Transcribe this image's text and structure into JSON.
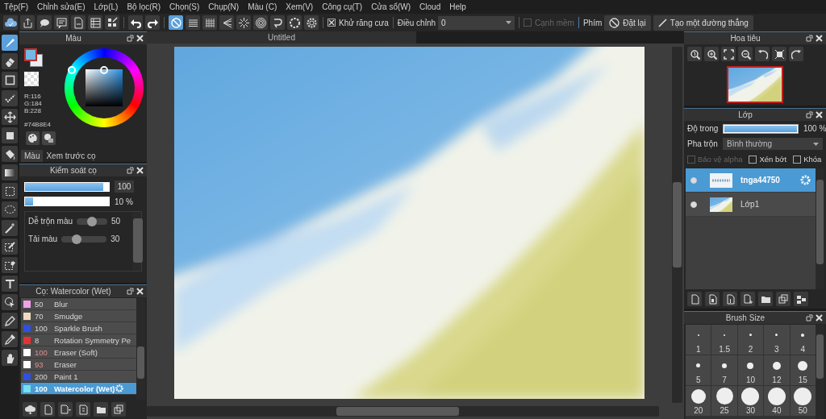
{
  "menu": [
    "Tệp(F)",
    "Chỉnh sửa(E)",
    "Lớp(L)",
    "Bộ lọc(R)",
    "Chọn(S)",
    "Chụp(N)",
    "Màu (C)",
    "Xem(V)",
    "Công cụ(T)",
    "Cửa sổ(W)",
    "Cloud",
    "Help"
  ],
  "toolbar": {
    "snap_tools": [
      {
        "kind": "off",
        "selected": true
      },
      {
        "kind": "parallel",
        "selected": false
      },
      {
        "kind": "grid",
        "selected": false
      },
      {
        "kind": "focus",
        "selected": false
      },
      {
        "kind": "radial",
        "selected": false
      },
      {
        "kind": "concentric",
        "selected": false
      },
      {
        "kind": "curve",
        "selected": false
      },
      {
        "kind": "circle",
        "selected": false
      },
      {
        "kind": "gear",
        "selected": false
      }
    ],
    "antialias": {
      "label": "Khử răng cưa",
      "checked": true
    },
    "correction": {
      "label": "Điều chỉnh",
      "value": "0"
    },
    "soft_edge": {
      "label": "Cạnh mềm",
      "checked": false,
      "disabled": true
    },
    "key_label": "Phím",
    "reset_button": "Đặt lại",
    "line_button": "Tạo một đường thẳng"
  },
  "tools": [
    {
      "kind": "brush",
      "selected": true
    },
    {
      "kind": "eraser",
      "selected": false
    },
    {
      "kind": "dot",
      "selected": false
    },
    {
      "kind": "graphic",
      "selected": false
    },
    {
      "kind": "move",
      "selected": false
    },
    {
      "kind": "fill",
      "selected": false
    },
    {
      "kind": "bucket",
      "selected": false
    },
    {
      "kind": "gradient",
      "selected": false
    },
    {
      "kind": "select",
      "selected": false
    },
    {
      "kind": "lasso",
      "selected": false
    },
    {
      "kind": "wand",
      "selected": false
    },
    {
      "kind": "select_pen",
      "selected": false
    },
    {
      "kind": "select_eraser",
      "selected": false
    },
    {
      "kind": "text",
      "selected": false
    },
    {
      "kind": "operation",
      "selected": false
    },
    {
      "kind": "pen",
      "selected": false
    },
    {
      "kind": "eyedropper",
      "selected": false
    },
    {
      "kind": "hand",
      "selected": false
    }
  ],
  "color_panel": {
    "title": "Màu",
    "hex": "#74B8E4",
    "rgb": [
      "R:116",
      "G:184",
      "B:228"
    ],
    "tabs": [
      {
        "label": "Màu",
        "selected": true
      },
      {
        "label": "Xem trước cọ",
        "selected": false
      }
    ]
  },
  "brush_control": {
    "title": "Kiểm soát cọ",
    "size": {
      "level": 0.93,
      "reading": "100"
    },
    "opacity": {
      "level": 0.1,
      "reading": "10 %"
    },
    "sliders": [
      {
        "label": "Dễ trộn màu",
        "level": 0.5,
        "reading": "50"
      },
      {
        "label": "Tải màu",
        "level": 0.3,
        "reading": "30"
      }
    ]
  },
  "brushes": {
    "title": "Cọ: Watercolor (Wet)",
    "items": [
      {
        "color": "#f0a0e8",
        "size": "50",
        "name": "Blur",
        "kind": "brush",
        "selected": false
      },
      {
        "color": "#f2dcc0",
        "size": "70",
        "name": "Smudge",
        "kind": "brush",
        "selected": false
      },
      {
        "color": "#3050e0",
        "size": "100",
        "name": "Sparkle Brush",
        "kind": "brush",
        "selected": false
      },
      {
        "color": "#e83030",
        "size": "8",
        "name": "Rotation Symmetry Pe",
        "kind": "brush",
        "selected": false
      },
      {
        "color": "#ffffff",
        "size": "100",
        "name": "Eraser (Soft)",
        "kind": "eraser",
        "selected": false
      },
      {
        "color": "#ffffff",
        "size": "93",
        "name": "Eraser",
        "kind": "eraser",
        "selected": false
      },
      {
        "color": "#3050e0",
        "size": "200",
        "name": "Paint 1",
        "kind": "brush",
        "selected": false
      },
      {
        "color": "#74e0f0",
        "size": "100",
        "name": "Watercolor (Wet)",
        "kind": "brush",
        "selected": true
      }
    ]
  },
  "canvas": {
    "tab": "Untitled"
  },
  "navigator": {
    "title": "Hoa tiêu"
  },
  "layers": {
    "title": "Lớp",
    "opacity": {
      "label": "Độ trong",
      "level": 1,
      "reading": "100 %"
    },
    "blend": {
      "label": "Pha trộn",
      "value": "Bình thường"
    },
    "options": [
      {
        "label": "Bảo vệ alpha",
        "checked": false,
        "disabled": true
      },
      {
        "label": "Xén bớt",
        "checked": false,
        "disabled": false
      },
      {
        "label": "Khóa",
        "checked": false,
        "disabled": false
      }
    ],
    "items": [
      {
        "name": "tnga44750",
        "kind": "text",
        "visible": true,
        "selected": true
      },
      {
        "name": "Lớp1",
        "kind": "raster",
        "visible": true,
        "selected": false
      }
    ]
  },
  "brush_size": {
    "title": "Brush Size",
    "sizes": [
      "1",
      "1.5",
      "2",
      "3",
      "4",
      "5",
      "7",
      "10",
      "12",
      "15",
      "20",
      "25",
      "30",
      "40",
      "50"
    ]
  }
}
